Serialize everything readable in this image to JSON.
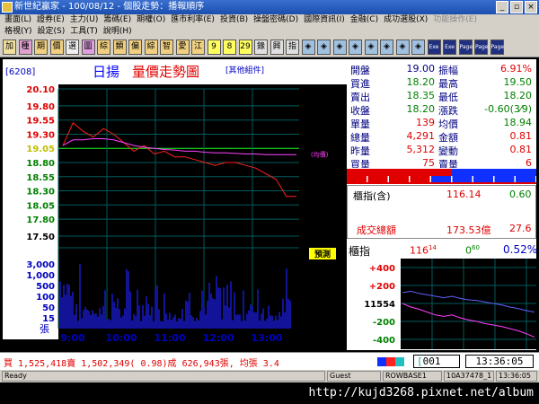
{
  "window": {
    "title": "新世紀贏家 - 100/08/12 - 個股走勢：播報順序",
    "buttons": [
      "_",
      "▫",
      "×"
    ]
  },
  "menu": {
    "row1": [
      "畫面(L)",
      "證券(E)",
      "主力(U)",
      "籌碼(E)",
      "期權(O)",
      "匯市利率(E)",
      "投資(B)",
      "操盤密碼(D)",
      "國際資訊(I)",
      "金融(C)",
      "成功選股(X)",
      "功能操作(E)"
    ],
    "row2": [
      "格視(Y)",
      "設定(S)",
      "工具(T)",
      "說明(H)"
    ]
  },
  "toolbar": {
    "buttons": [
      "加",
      "種",
      "期",
      "價",
      "選",
      "圖",
      "綜",
      "類",
      "偏",
      "綜",
      "智",
      "愛",
      "江",
      "9",
      "8",
      "29",
      "錄",
      "興",
      "指",
      "◈",
      "◈",
      "◈",
      "◈",
      "◈",
      "◈",
      "◈",
      "◈",
      "Exe",
      "Exe",
      "Page",
      "Page",
      "Page"
    ]
  },
  "chart": {
    "stock_code": "[6208]",
    "stock_name": "日揚",
    "title": "量價走勢圖",
    "component_link": "[其他組件]",
    "avg_line_label": "(均價)",
    "volume_unit": "張",
    "badge": "預測",
    "price_ticks": [
      "20.10",
      "19.80",
      "19.55",
      "19.30",
      "19.05",
      "18.80",
      "18.55",
      "18.30",
      "18.05",
      "17.80",
      "17.50"
    ],
    "volume_ticks": [
      "3,000",
      "1,000",
      "500",
      "100",
      "50",
      "15"
    ],
    "time_ticks": [
      "9:00",
      "10:00",
      "11:00",
      "12:00",
      "13:00"
    ],
    "colors": {
      "price": "#ff2020",
      "avg": "#ff40ff",
      "volume": "#2020ff",
      "ref": "#20ff20",
      "grid": "#005c5c"
    }
  },
  "chart_data": {
    "type": "line",
    "title": "量價走勢圖",
    "x": [
      "9:00",
      "9:05",
      "9:10",
      "9:15",
      "9:20",
      "9:30",
      "9:45",
      "10:00",
      "10:15",
      "10:30",
      "10:45",
      "11:00",
      "11:15",
      "11:30",
      "11:45",
      "12:00",
      "12:15",
      "12:30",
      "12:45",
      "13:00",
      "13:10",
      "13:20",
      "13:25",
      "13:30"
    ],
    "series": [
      {
        "name": "成交價",
        "values": [
          19.1,
          19.5,
          19.35,
          19.25,
          19.4,
          19.3,
          19.15,
          19.0,
          19.1,
          18.95,
          19.0,
          18.9,
          18.9,
          18.85,
          18.8,
          18.75,
          18.8,
          18.8,
          18.75,
          18.7,
          18.6,
          18.5,
          18.2,
          18.2
        ]
      },
      {
        "name": "均價",
        "values": [
          19.1,
          19.2,
          19.2,
          19.22,
          19.22,
          19.2,
          19.15,
          19.1,
          19.07,
          19.05,
          19.03,
          19.02,
          19.0,
          19.0,
          18.98,
          18.97,
          18.97,
          18.96,
          18.95,
          18.95,
          18.94,
          18.94,
          18.94,
          18.94
        ]
      }
    ],
    "ylim": [
      17.5,
      20.1
    ],
    "reference_price": 19.05
  },
  "quote": {
    "rows": [
      {
        "l1": "開盤",
        "v1": "19.00",
        "c1": "#000080",
        "l2": "振幅",
        "v2": "6.91%",
        "c2": "#e00000"
      },
      {
        "l1": "買進",
        "v1": "18.20",
        "c1": "#008000",
        "l2": "最高",
        "v2": "19.50",
        "c2": "#008000"
      },
      {
        "l1": "賣出",
        "v1": "18.35",
        "c1": "#008000",
        "l2": "最低",
        "v2": "18.20",
        "c2": "#008000"
      },
      {
        "l1": "收盤",
        "v1": "18.20",
        "c1": "#008000",
        "l2": "漲跌",
        "v2": "-0.60(3⁄9)",
        "c2": "#008000"
      },
      {
        "l1": "單量",
        "v1": "139",
        "c1": "#e00000",
        "l2": "均價",
        "v2": "18.94",
        "c2": "#008000"
      },
      {
        "l1": "總量",
        "v1": "4,291",
        "c1": "#e00000",
        "l2": "金額",
        "v2": "0.81",
        "c2": "#e00000"
      },
      {
        "l1": "昨量",
        "v1": "5,312",
        "c1": "#e00000",
        "l2": "變動",
        "v2": "0.81",
        "c2": "#e00000"
      },
      {
        "l1": "買量",
        "v1": "75",
        "c1": "#e00000",
        "l2": "賣量",
        "v2": "6",
        "c2": "#e00000"
      }
    ],
    "buy_ratio": 0.55
  },
  "index_box": {
    "label": "櫃指(含)",
    "value": "116.14",
    "change": "0.60"
  },
  "turnover": {
    "label": "成交總額",
    "value": "173.53億",
    "change": "27.6"
  },
  "otc": {
    "label": "櫃指",
    "value": "116",
    "value_frac": "14",
    "change": "0",
    "change_frac": "60",
    "pct": "0.52%",
    "ticks": [
      "+400",
      "+200",
      "11554",
      "-200",
      "-400"
    ],
    "base_label": "11554"
  },
  "otc_chart": {
    "index": [
      0.35,
      0.33,
      0.36,
      0.38,
      0.4,
      0.42,
      0.4,
      0.43,
      0.45,
      0.46,
      0.48,
      0.5,
      0.52,
      0.55,
      0.57,
      0.6,
      0.62
    ],
    "pink": [
      0.5,
      0.55,
      0.58,
      0.62,
      0.66,
      0.68,
      0.66,
      0.7,
      0.73,
      0.75,
      0.78,
      0.8,
      0.82,
      0.85,
      0.88,
      0.92,
      0.97
    ]
  },
  "status": {
    "text": "買 1,525,418賣 1,502,349( 0.98)成 626,943張, 均張 3.4",
    "input": "001",
    "time": "13:36:05"
  },
  "statusbar": [
    "Ready",
    "Guest",
    "ROWBASE1",
    "10A37478_1",
    "13:36:05"
  ],
  "footer_url": "http://kujd3268.pixnet.net/album"
}
